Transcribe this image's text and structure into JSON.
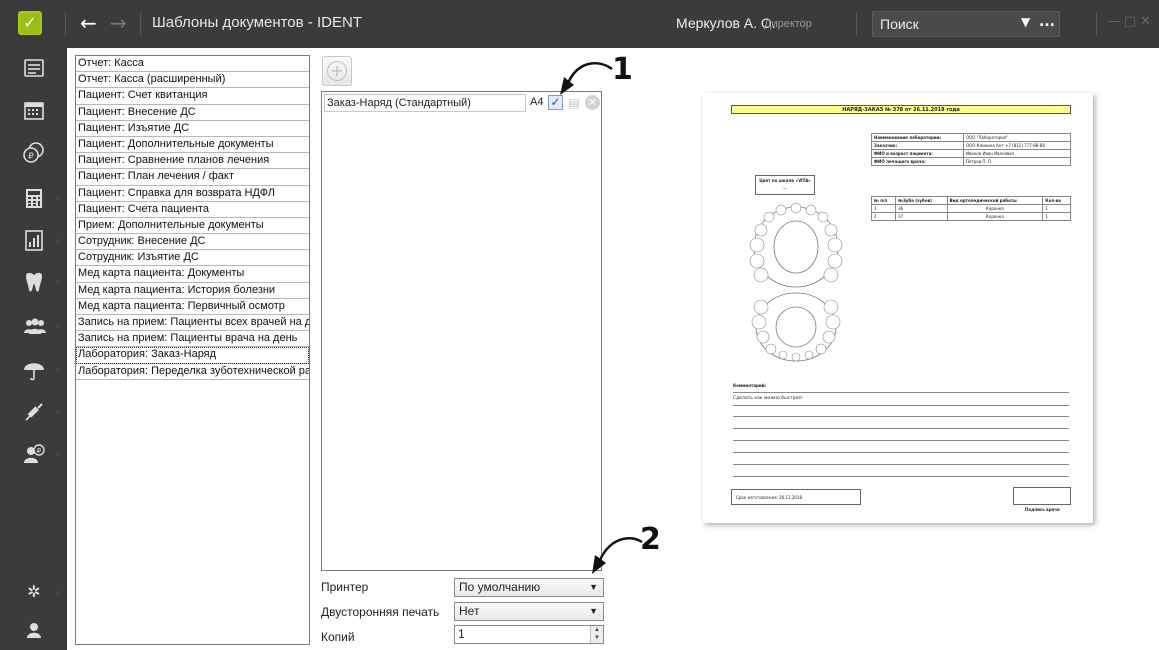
{
  "titlebar": {
    "title": "Шаблоны документов - IDENT",
    "user": "Меркулов А. О.",
    "role": "Директор",
    "search_placeholder": "Поиск",
    "search_more": "..."
  },
  "sidebar": {
    "icons": [
      "list-icon",
      "calendar-icon",
      "coins-icon",
      "calculator-icon",
      "chart-icon",
      "tooth-icon",
      "people-icon",
      "umbrella-icon",
      "syringe-icon",
      "user-money-icon",
      "settings-icon",
      "user-icon"
    ]
  },
  "documents": [
    "Отчет: Касса",
    "Отчет: Касса (расширенный)",
    "Пациент: Счет квитанция",
    "Пациент: Внесение ДС",
    "Пациент: Изъятие ДС",
    "Пациент: Дополнительные документы",
    "Пациент: Сравнение планов лечения",
    "Пациент: План лечения / факт",
    "Пациент: Справка для возврата НДФЛ",
    "Пациент: Счета пациента",
    "Прием: Дополнительные документы",
    "Сотрудник: Внесение ДС",
    "Сотрудник: Изъятие ДС",
    "Мед карта пациента: Документы",
    "Мед карта пациента: История болезни",
    "Мед карта пациента: Первичный осмотр",
    "Запись на прием: Пациенты всех врачей на ден",
    "Запись на прием: Пациенты врача на день",
    "Лаборатория: Заказ-Наряд",
    "Лаборатория: Переделка зуботехнической рабо"
  ],
  "selected_document_index": 18,
  "templates": [
    {
      "name": "Заказ-Наряд (Стандартный)",
      "format": "A4",
      "checked": "✓"
    }
  ],
  "annotations": {
    "one": "1",
    "two": "2"
  },
  "settings": {
    "printer_label": "Принтер",
    "printer_value": "По умолчанию",
    "duplex_label": "Двусторонняя печать",
    "duplex_value": "Нет",
    "copies_label": "Копий",
    "copies_value": "1"
  },
  "preview": {
    "header": "НАРЯД-ЗАКАЗ № 378 от 26.11.2018 года",
    "lab_rows": [
      [
        "Наименование лаборатории:",
        "ООО \"Лаборатория\""
      ],
      [
        "Заказчик:",
        "ООО Клиника Ант +7 (812) 777-88-88"
      ],
      [
        "ФИО и возраст пациента:",
        "Иванов Иван Иванович"
      ],
      [
        "ФИО лечащего врача:",
        "Петров П. П."
      ]
    ],
    "shade_label": "Цвет по шкале «VITA»",
    "shade_value": "—",
    "work_header": [
      "№ п/п",
      "№Зуба (зубов)",
      "Вид ортопедической работы",
      "Кол-во"
    ],
    "work_rows": [
      [
        "1",
        "36",
        "Коронка",
        "1"
      ],
      [
        "2",
        "37",
        "Коронка",
        "1"
      ]
    ],
    "comment_label": "Комментарий:",
    "comment_text": "Сделать как можно быстрее!",
    "term": "Срок изготовления: 26.11.2018",
    "signature": "Подпись врача"
  }
}
